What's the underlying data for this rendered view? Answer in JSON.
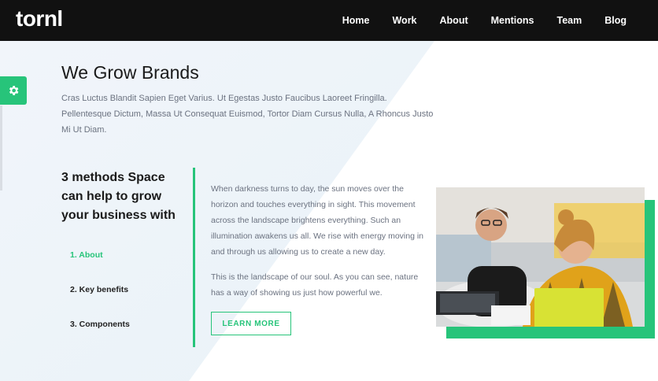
{
  "brand": {
    "logo": "tornl"
  },
  "nav": {
    "items": [
      {
        "label": "Home"
      },
      {
        "label": "Work"
      },
      {
        "label": "About"
      },
      {
        "label": "Mentions"
      },
      {
        "label": "Team"
      },
      {
        "label": "Blog"
      }
    ]
  },
  "hero": {
    "title": "We Grow Brands",
    "description": "Cras Luctus Blandit Sapien Eget Varius. Ut Egestas Justo Faucibus Laoreet Fringilla. Pellentesque Dictum, Massa Ut Consequat Euismod, Tortor Diam Cursus Nulla, A Rhoncus Justo Mi Ut Diam."
  },
  "methods": {
    "title": "3 methods Space can help to grow your business with",
    "steps": [
      {
        "label": "1. About",
        "active": true
      },
      {
        "label": "2. Key benefits",
        "active": false
      },
      {
        "label": "3. Components",
        "active": false
      }
    ]
  },
  "content": {
    "paragraph_1": "When darkness turns to day, the sun moves over the horizon and touches everything in sight. This movement across the landscape brightens everything. Such an illumination awakens us all. We rise with energy moving in and through us allowing us to create a new day.",
    "paragraph_2": "This is the landscape of our soul. As you can see, nature has a way of showing us just how powerful we.",
    "button_label": "LEARN MORE"
  },
  "settings": {
    "icon": "gear-icon"
  },
  "colors": {
    "accent": "#27c47a",
    "nav_bg": "#111111",
    "bg_tint": "#eef4f9",
    "muted_text": "#6b7280"
  }
}
